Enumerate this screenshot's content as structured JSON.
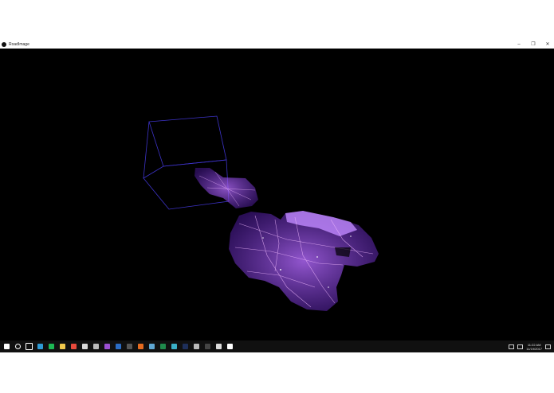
{
  "window": {
    "title": "RoadImage",
    "icon": "app-circle-icon",
    "controls": {
      "minimize": "–",
      "maximize": "❐",
      "close": "✕"
    }
  },
  "viewport": {
    "background": "#000000",
    "map_color": "#8a2be2",
    "highlight_color": "#f0b8ff",
    "bbox_color": "#3d33c8"
  },
  "taskbar": {
    "background": "#101010",
    "icons": [
      {
        "name": "start-icon",
        "color": "#ffffff"
      },
      {
        "name": "search-icon",
        "color": "#ffffff"
      },
      {
        "name": "task-view-icon",
        "color": "#ffffff"
      },
      {
        "name": "globe-icon",
        "color": "#2e9bd6"
      },
      {
        "name": "spotify-icon",
        "color": "#1db954"
      },
      {
        "name": "file-explorer-icon",
        "color": "#f2c94c"
      },
      {
        "name": "chrome-icon",
        "color": "#e84a3c"
      },
      {
        "name": "download-icon",
        "color": "#d9d9d9"
      },
      {
        "name": "vr-icon",
        "color": "#bbbbbb"
      },
      {
        "name": "onenote-icon",
        "color": "#9b4fd1"
      },
      {
        "name": "word-icon",
        "color": "#2b6cc4"
      },
      {
        "name": "terminal-icon",
        "color": "#555555"
      },
      {
        "name": "app-orange-icon",
        "color": "#e56b1f"
      },
      {
        "name": "photos-icon",
        "color": "#5fa8d3"
      },
      {
        "name": "excel-icon",
        "color": "#1f8a4c"
      },
      {
        "name": "cube-icon",
        "color": "#3ab0c8"
      },
      {
        "name": "photoshop-icon",
        "color": "#1e2f5a"
      },
      {
        "name": "settings-icon",
        "color": "#bbbbbb"
      },
      {
        "name": "app-dark-icon",
        "color": "#444444"
      },
      {
        "name": "printer-icon",
        "color": "#dddddd"
      },
      {
        "name": "app-active-icon",
        "color": "#ffffff"
      }
    ],
    "clock": {
      "time": "11:22 AM",
      "date": "11/19/2017"
    }
  }
}
